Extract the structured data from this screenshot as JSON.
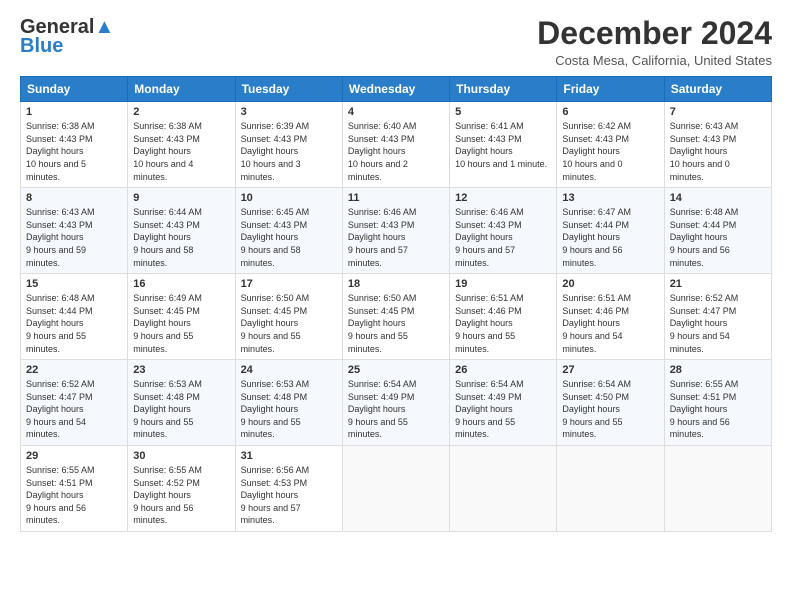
{
  "header": {
    "logo_line1": "General",
    "logo_line2": "Blue",
    "month_title": "December 2024",
    "location": "Costa Mesa, California, United States"
  },
  "calendar": {
    "days_of_week": [
      "Sunday",
      "Monday",
      "Tuesday",
      "Wednesday",
      "Thursday",
      "Friday",
      "Saturday"
    ],
    "weeks": [
      [
        {
          "day": "1",
          "sunrise": "6:38 AM",
          "sunset": "4:43 PM",
          "daylight": "10 hours and 5 minutes."
        },
        {
          "day": "2",
          "sunrise": "6:38 AM",
          "sunset": "4:43 PM",
          "daylight": "10 hours and 4 minutes."
        },
        {
          "day": "3",
          "sunrise": "6:39 AM",
          "sunset": "4:43 PM",
          "daylight": "10 hours and 3 minutes."
        },
        {
          "day": "4",
          "sunrise": "6:40 AM",
          "sunset": "4:43 PM",
          "daylight": "10 hours and 2 minutes."
        },
        {
          "day": "5",
          "sunrise": "6:41 AM",
          "sunset": "4:43 PM",
          "daylight": "10 hours and 1 minute."
        },
        {
          "day": "6",
          "sunrise": "6:42 AM",
          "sunset": "4:43 PM",
          "daylight": "10 hours and 0 minutes."
        },
        {
          "day": "7",
          "sunrise": "6:43 AM",
          "sunset": "4:43 PM",
          "daylight": "10 hours and 0 minutes."
        }
      ],
      [
        {
          "day": "8",
          "sunrise": "6:43 AM",
          "sunset": "4:43 PM",
          "daylight": "9 hours and 59 minutes."
        },
        {
          "day": "9",
          "sunrise": "6:44 AM",
          "sunset": "4:43 PM",
          "daylight": "9 hours and 58 minutes."
        },
        {
          "day": "10",
          "sunrise": "6:45 AM",
          "sunset": "4:43 PM",
          "daylight": "9 hours and 58 minutes."
        },
        {
          "day": "11",
          "sunrise": "6:46 AM",
          "sunset": "4:43 PM",
          "daylight": "9 hours and 57 minutes."
        },
        {
          "day": "12",
          "sunrise": "6:46 AM",
          "sunset": "4:43 PM",
          "daylight": "9 hours and 57 minutes."
        },
        {
          "day": "13",
          "sunrise": "6:47 AM",
          "sunset": "4:44 PM",
          "daylight": "9 hours and 56 minutes."
        },
        {
          "day": "14",
          "sunrise": "6:48 AM",
          "sunset": "4:44 PM",
          "daylight": "9 hours and 56 minutes."
        }
      ],
      [
        {
          "day": "15",
          "sunrise": "6:48 AM",
          "sunset": "4:44 PM",
          "daylight": "9 hours and 55 minutes."
        },
        {
          "day": "16",
          "sunrise": "6:49 AM",
          "sunset": "4:45 PM",
          "daylight": "9 hours and 55 minutes."
        },
        {
          "day": "17",
          "sunrise": "6:50 AM",
          "sunset": "4:45 PM",
          "daylight": "9 hours and 55 minutes."
        },
        {
          "day": "18",
          "sunrise": "6:50 AM",
          "sunset": "4:45 PM",
          "daylight": "9 hours and 55 minutes."
        },
        {
          "day": "19",
          "sunrise": "6:51 AM",
          "sunset": "4:46 PM",
          "daylight": "9 hours and 55 minutes."
        },
        {
          "day": "20",
          "sunrise": "6:51 AM",
          "sunset": "4:46 PM",
          "daylight": "9 hours and 54 minutes."
        },
        {
          "day": "21",
          "sunrise": "6:52 AM",
          "sunset": "4:47 PM",
          "daylight": "9 hours and 54 minutes."
        }
      ],
      [
        {
          "day": "22",
          "sunrise": "6:52 AM",
          "sunset": "4:47 PM",
          "daylight": "9 hours and 54 minutes."
        },
        {
          "day": "23",
          "sunrise": "6:53 AM",
          "sunset": "4:48 PM",
          "daylight": "9 hours and 55 minutes."
        },
        {
          "day": "24",
          "sunrise": "6:53 AM",
          "sunset": "4:48 PM",
          "daylight": "9 hours and 55 minutes."
        },
        {
          "day": "25",
          "sunrise": "6:54 AM",
          "sunset": "4:49 PM",
          "daylight": "9 hours and 55 minutes."
        },
        {
          "day": "26",
          "sunrise": "6:54 AM",
          "sunset": "4:49 PM",
          "daylight": "9 hours and 55 minutes."
        },
        {
          "day": "27",
          "sunrise": "6:54 AM",
          "sunset": "4:50 PM",
          "daylight": "9 hours and 55 minutes."
        },
        {
          "day": "28",
          "sunrise": "6:55 AM",
          "sunset": "4:51 PM",
          "daylight": "9 hours and 56 minutes."
        }
      ],
      [
        {
          "day": "29",
          "sunrise": "6:55 AM",
          "sunset": "4:51 PM",
          "daylight": "9 hours and 56 minutes."
        },
        {
          "day": "30",
          "sunrise": "6:55 AM",
          "sunset": "4:52 PM",
          "daylight": "9 hours and 56 minutes."
        },
        {
          "day": "31",
          "sunrise": "6:56 AM",
          "sunset": "4:53 PM",
          "daylight": "9 hours and 57 minutes."
        },
        null,
        null,
        null,
        null
      ]
    ]
  }
}
